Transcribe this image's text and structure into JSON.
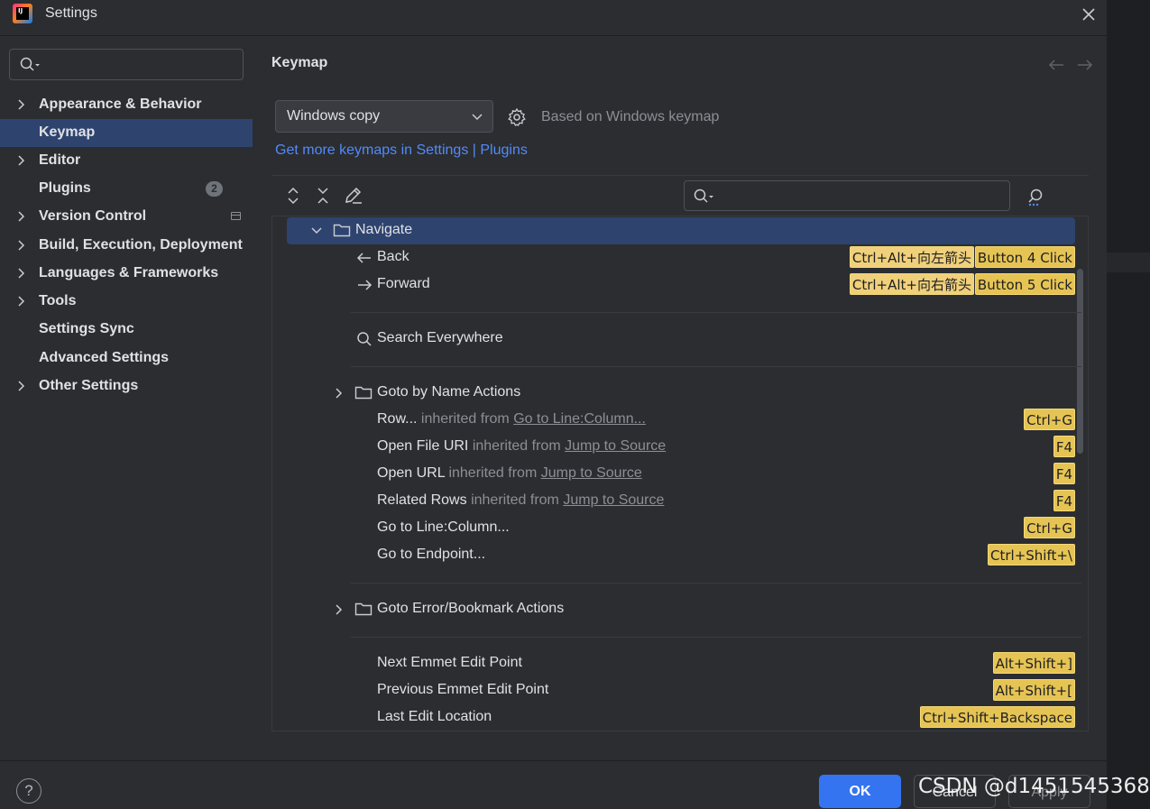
{
  "window": {
    "title": "Settings",
    "app_icon_text": "IJ"
  },
  "sidebar": {
    "search_placeholder": "",
    "items": [
      {
        "label": "Appearance & Behavior",
        "expandable": true,
        "selected": false
      },
      {
        "label": "Keymap",
        "expandable": false,
        "selected": true
      },
      {
        "label": "Editor",
        "expandable": true,
        "selected": false
      },
      {
        "label": "Plugins",
        "expandable": false,
        "selected": false,
        "badge": "2"
      },
      {
        "label": "Version Control",
        "expandable": true,
        "selected": false
      },
      {
        "label": "Build, Execution, Deployment",
        "expandable": true,
        "selected": false
      },
      {
        "label": "Languages & Frameworks",
        "expandable": true,
        "selected": false
      },
      {
        "label": "Tools",
        "expandable": true,
        "selected": false
      },
      {
        "label": "Settings Sync",
        "expandable": false,
        "selected": false
      },
      {
        "label": "Advanced Settings",
        "expandable": false,
        "selected": false
      },
      {
        "label": "Other Settings",
        "expandable": true,
        "selected": false
      }
    ]
  },
  "main": {
    "title": "Keymap",
    "keymap_select": "Windows copy",
    "based_on": "Based on Windows keymap",
    "plugins_link": "Get more keymaps in Settings | Plugins",
    "filter_placeholder": ""
  },
  "tree": {
    "group": "Navigate",
    "back": {
      "label": "Back",
      "shortcuts": [
        "Ctrl+Alt+向左箭头",
        "Button 4 Click"
      ]
    },
    "forward": {
      "label": "Forward",
      "shortcuts": [
        "Ctrl+Alt+向右箭头",
        "Button 5 Click"
      ]
    },
    "search_everywhere": "Search Everywhere",
    "goto_by_name": "Goto by Name Actions",
    "inherited_word": "inherited from",
    "rows": [
      {
        "label": "Row...",
        "from": "Go to Line:Column...",
        "shortcut": "Ctrl+G"
      },
      {
        "label": "Open File URI",
        "from": "Jump to Source",
        "shortcut": "F4"
      },
      {
        "label": "Open URL",
        "from": "Jump to Source",
        "shortcut": "F4"
      },
      {
        "label": "Related Rows",
        "from": "Jump to Source",
        "shortcut": "F4"
      },
      {
        "label": "Go to Line:Column...",
        "from": "",
        "shortcut": "Ctrl+G"
      },
      {
        "label": "Go to Endpoint...",
        "from": "",
        "shortcut": "Ctrl+Shift+\\"
      }
    ],
    "goto_error": "Goto Error/Bookmark Actions",
    "emmet": [
      {
        "label": "Next Emmet Edit Point",
        "shortcut": "Alt+Shift+]"
      },
      {
        "label": "Previous Emmet Edit Point",
        "shortcut": "Alt+Shift+["
      },
      {
        "label": "Last Edit Location",
        "shortcut": "Ctrl+Shift+Backspace"
      }
    ]
  },
  "footer": {
    "help": "?",
    "ok": "OK",
    "cancel": "Cancel",
    "apply": "Apply"
  },
  "watermark": "CSDN @d1451545368",
  "colors": {
    "accent": "#3574f0",
    "selection": "#2e436e",
    "link": "#548af7",
    "shortcut_bg": "#e6c454"
  }
}
